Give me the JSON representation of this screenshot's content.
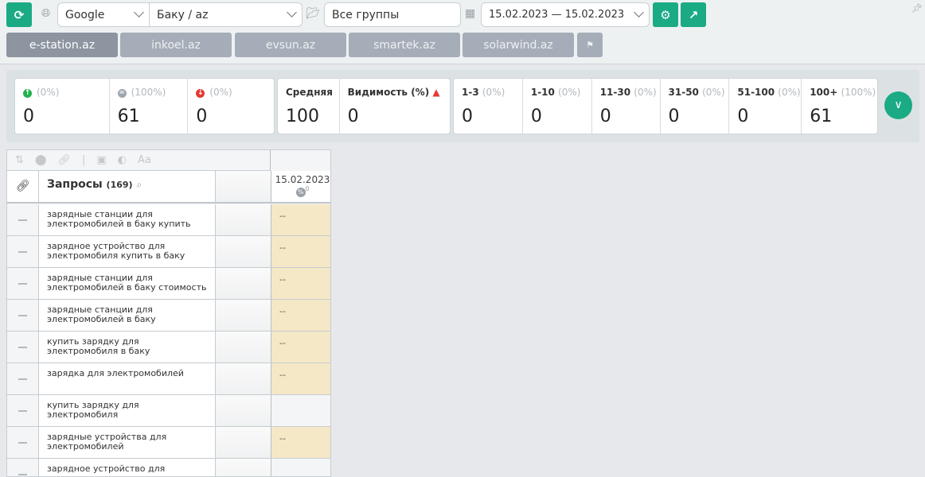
{
  "toolbar": {
    "engine": "Google",
    "region": "Баку / az",
    "group": "Все группы",
    "date_range": "15.02.2023 — 15.02.2023"
  },
  "tabs": [
    "e-station.az",
    "inkoel.az",
    "evsun.az",
    "smartek.az",
    "solarwind.az"
  ],
  "stats": {
    "up": {
      "pct": "(0%)",
      "value": "0"
    },
    "same": {
      "pct": "(100%)",
      "value": "61"
    },
    "down": {
      "pct": "(0%)",
      "value": "0"
    },
    "avg": {
      "label": "Средняя",
      "value": "100"
    },
    "visibility": {
      "label": "Видимость (%)",
      "value": "0"
    },
    "ranges": [
      {
        "label": "1-3",
        "pct": "(0%)",
        "value": "0"
      },
      {
        "label": "1-10",
        "pct": "(0%)",
        "value": "0"
      },
      {
        "label": "11-30",
        "pct": "(0%)",
        "value": "0"
      },
      {
        "label": "31-50",
        "pct": "(0%)",
        "value": "0"
      },
      {
        "label": "51-100",
        "pct": "(0%)",
        "value": "0"
      },
      {
        "label": "100+",
        "pct": "(100%)",
        "value": "61"
      }
    ]
  },
  "table": {
    "queries_label": "Запросы",
    "queries_count": "(169)",
    "date_header": "15.02.2023",
    "date_sub": "0",
    "rows": [
      {
        "query": "зарядные станции для электромобилей в баку купить",
        "value": "--"
      },
      {
        "query": "зарядное устройство для электромобиля купить в баку",
        "value": "--"
      },
      {
        "query": "зарядные станции для электромобилей в баку стоимость",
        "value": "--"
      },
      {
        "query": "зарядные станции для электромобилей в баку",
        "value": "--"
      },
      {
        "query": "купить зарядку для электромобиля в баку",
        "value": "--"
      },
      {
        "query": "зарядка для электромобилей",
        "value": "--"
      },
      {
        "query": "купить зарядку для электромобиля",
        "value": ""
      },
      {
        "query": "зарядные устройства для электромобилей",
        "value": "--"
      },
      {
        "query": "зарядное устройство для электрокара",
        "value": ""
      }
    ]
  },
  "colors": {
    "accent": "#1aaa84",
    "highlight": "#f5e8c6"
  }
}
